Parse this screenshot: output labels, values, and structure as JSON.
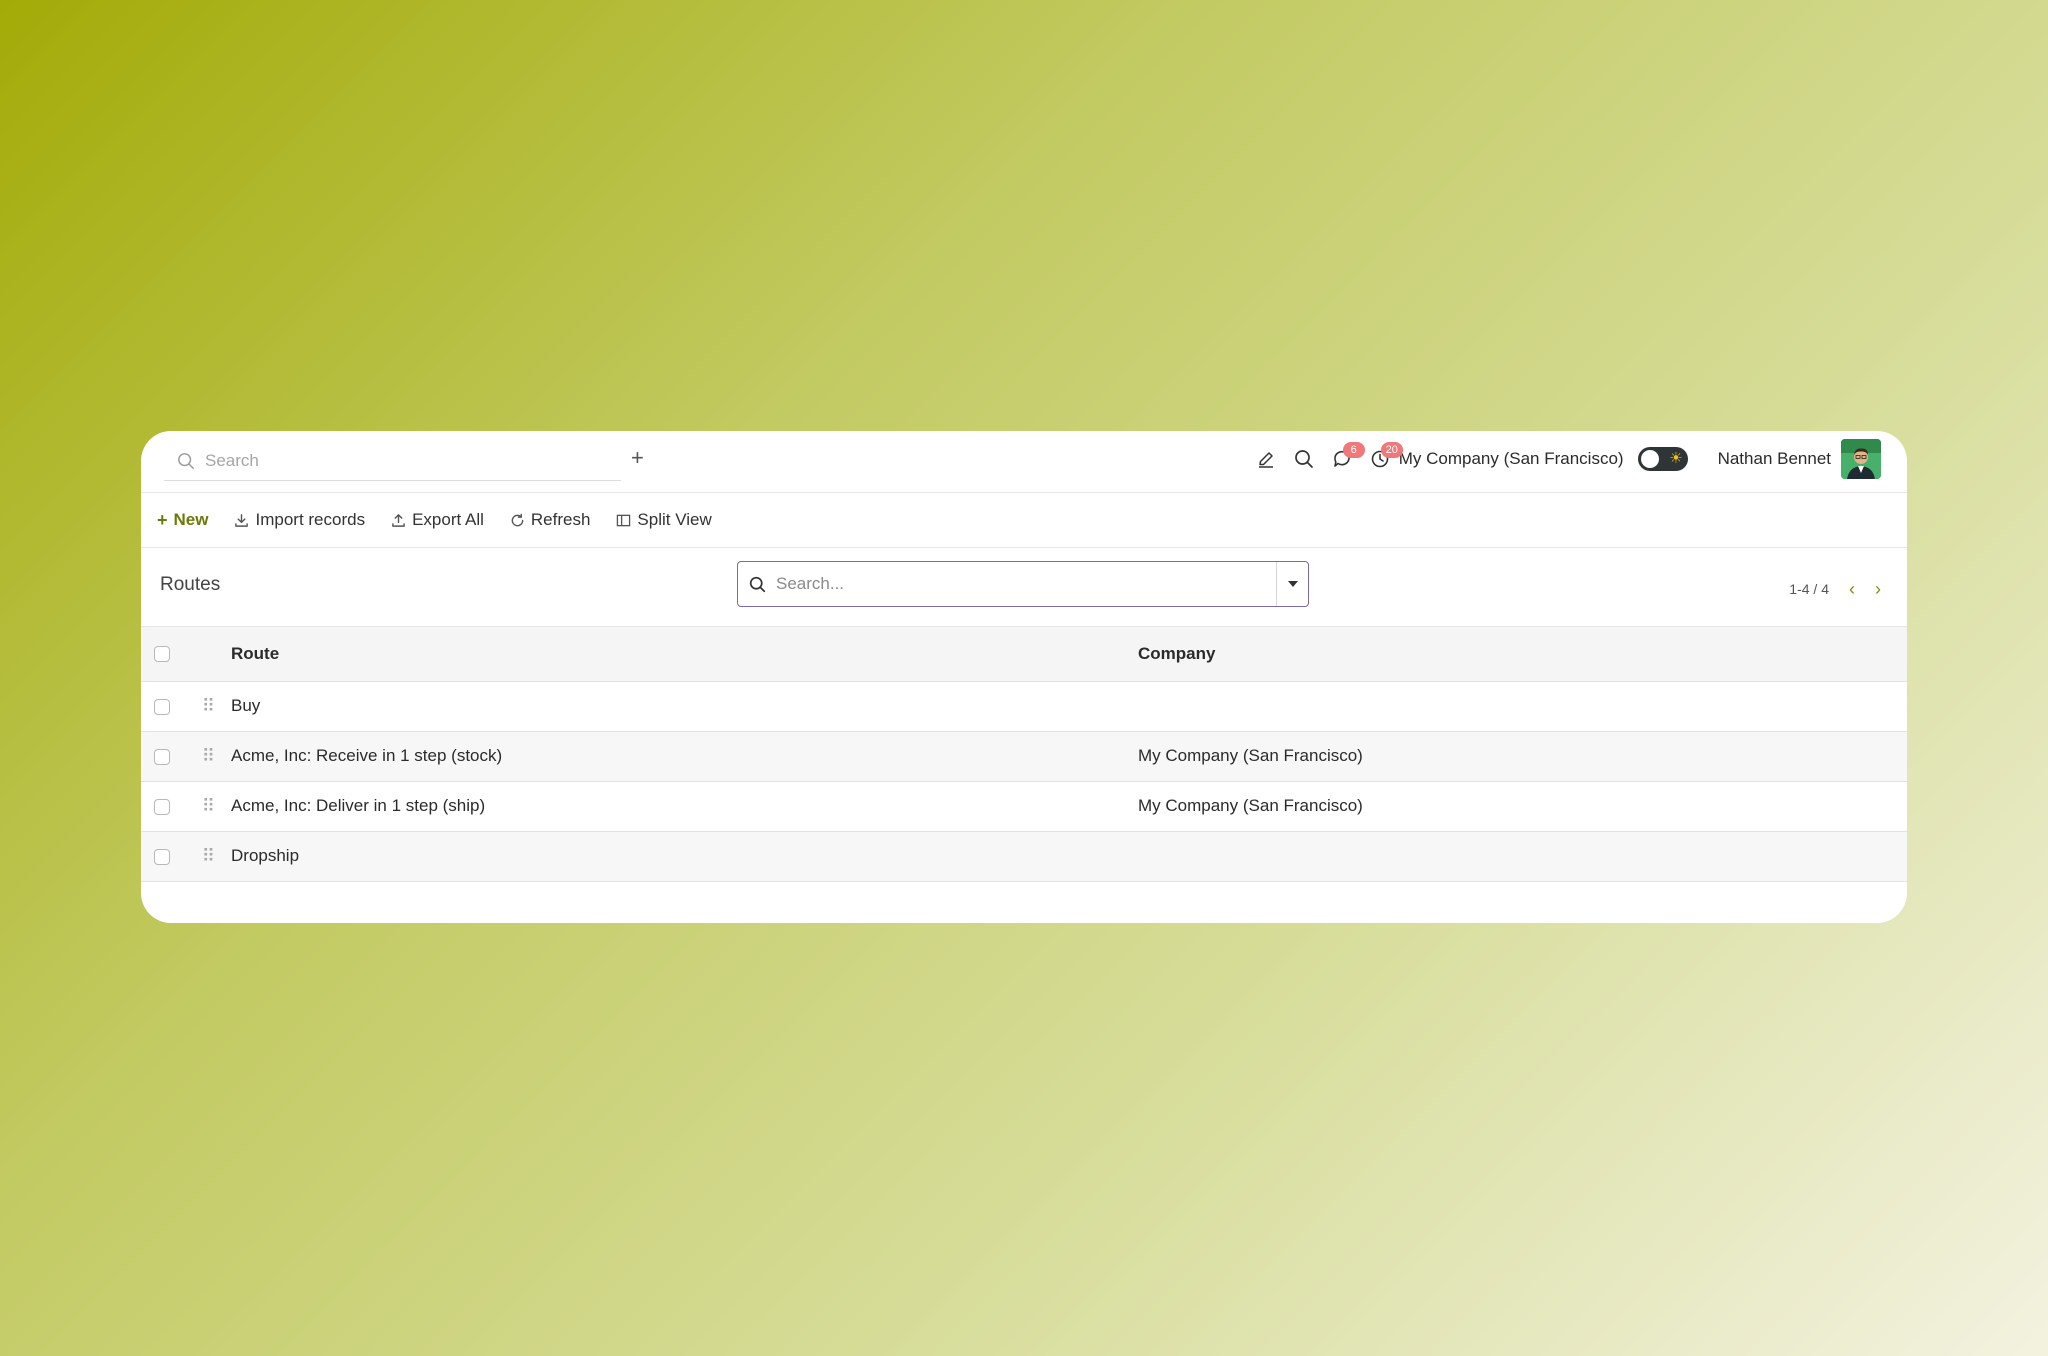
{
  "topbar": {
    "search_placeholder": "Search",
    "plus_label": "+",
    "messages_badge": "6",
    "activities_badge": "20",
    "company": "My Company (San Francisco)",
    "user_name": "Nathan Bennet"
  },
  "toolbar": {
    "new_label": "New",
    "import_label": "Import records",
    "export_label": "Export All",
    "refresh_label": "Refresh",
    "split_label": "Split View"
  },
  "control": {
    "title": "Routes",
    "search_placeholder": "Search...",
    "pager": "1-4 / 4"
  },
  "table": {
    "headers": {
      "route": "Route",
      "company": "Company"
    },
    "rows": [
      {
        "route": "Buy",
        "company": ""
      },
      {
        "route": "Acme, Inc: Receive in 1 step (stock)",
        "company": "My Company (San Francisco)"
      },
      {
        "route": "Acme, Inc: Deliver in 1 step (ship)",
        "company": "My Company (San Francisco)"
      },
      {
        "route": "Dropship",
        "company": ""
      }
    ]
  },
  "colors": {
    "accent": "#6b7a0a",
    "search_focus": "#7b68a8",
    "badge": "#f0777a"
  }
}
